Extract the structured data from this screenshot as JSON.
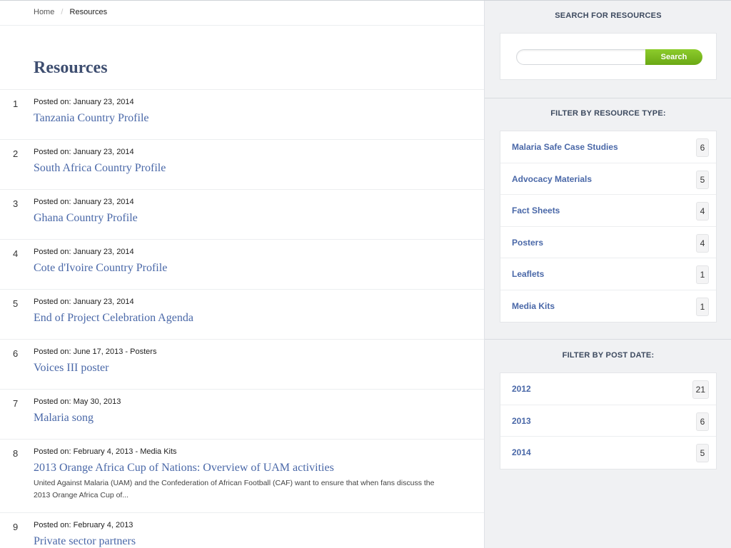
{
  "breadcrumb": {
    "home": "Home",
    "separator": "/",
    "current": "Resources"
  },
  "page": {
    "title": "Resources"
  },
  "resources": [
    {
      "num": "1",
      "meta": "Posted on: January 23, 2014",
      "title": "Tanzania Country Profile"
    },
    {
      "num": "2",
      "meta": "Posted on: January 23, 2014",
      "title": "South Africa Country Profile"
    },
    {
      "num": "3",
      "meta": "Posted on: January 23, 2014",
      "title": "Ghana Country Profile"
    },
    {
      "num": "4",
      "meta": "Posted on: January 23, 2014",
      "title": "Cote d'Ivoire Country Profile"
    },
    {
      "num": "5",
      "meta": "Posted on: January 23, 2014",
      "title": "End of Project Celebration Agenda"
    },
    {
      "num": "6",
      "meta": "Posted on: June 17, 2013 - Posters",
      "title": "Voices III poster"
    },
    {
      "num": "7",
      "meta": "Posted on: May 30, 2013",
      "title": "Malaria song"
    },
    {
      "num": "8",
      "meta": "Posted on: February 4, 2013 - Media Kits",
      "title": "2013 Orange Africa Cup of Nations: Overview of UAM activities",
      "excerpt": "United Against Malaria (UAM) and the Confederation of African Football (CAF) want to ensure that when fans discuss the 2013 Orange Africa Cup of..."
    },
    {
      "num": "9",
      "meta": "Posted on: February 4, 2013",
      "title": "Private sector partners"
    }
  ],
  "sidebar": {
    "search": {
      "heading": "SEARCH FOR RESOURCES",
      "placeholder": "",
      "button_label": "Search",
      "button_color": "#7bbd1f"
    },
    "resource_type": {
      "heading": "FILTER BY RESOURCE TYPE:",
      "items": [
        {
          "label": "Malaria Safe Case Studies",
          "count": "6"
        },
        {
          "label": "Advocacy Materials",
          "count": "5"
        },
        {
          "label": "Fact Sheets",
          "count": "4"
        },
        {
          "label": "Posters",
          "count": "4"
        },
        {
          "label": "Leaflets",
          "count": "1"
        },
        {
          "label": "Media Kits",
          "count": "1"
        }
      ]
    },
    "post_date": {
      "heading": "FILTER BY POST DATE:",
      "items": [
        {
          "label": "2012",
          "count": "21"
        },
        {
          "label": "2013",
          "count": "6"
        },
        {
          "label": "2014",
          "count": "5"
        }
      ]
    }
  },
  "colors": {
    "link": "#4a68a8",
    "title": "#3e4e70",
    "sidebar_bg": "#f0f1f3",
    "accent_green": "#7bbd1f"
  }
}
